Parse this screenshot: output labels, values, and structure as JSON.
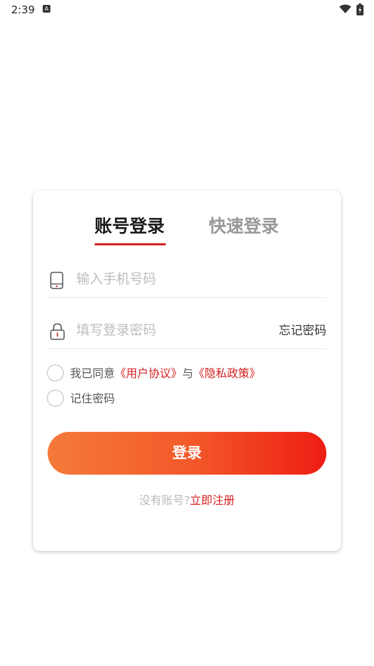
{
  "status_bar": {
    "time": "2:39",
    "notification_icon": "A"
  },
  "login": {
    "tabs": [
      {
        "label": "账号登录",
        "active": true
      },
      {
        "label": "快速登录",
        "active": false
      }
    ],
    "phone": {
      "icon": "phone-icon",
      "placeholder": "输入手机号码"
    },
    "password": {
      "icon": "lock-icon",
      "placeholder": "填写登录密码",
      "forgot": "忘记密码"
    },
    "agreement": {
      "prefix": "我已同意",
      "user_agreement": "《用户协议》",
      "and": "与",
      "privacy_policy": "《隐私政策》"
    },
    "remember": "记住密码",
    "submit": "登录",
    "register_prompt": "没有账号?",
    "register_link": "立即注册"
  },
  "colors": {
    "accent": "#d42020",
    "button_start": "#f47a3a",
    "button_end": "#ee1d14"
  }
}
